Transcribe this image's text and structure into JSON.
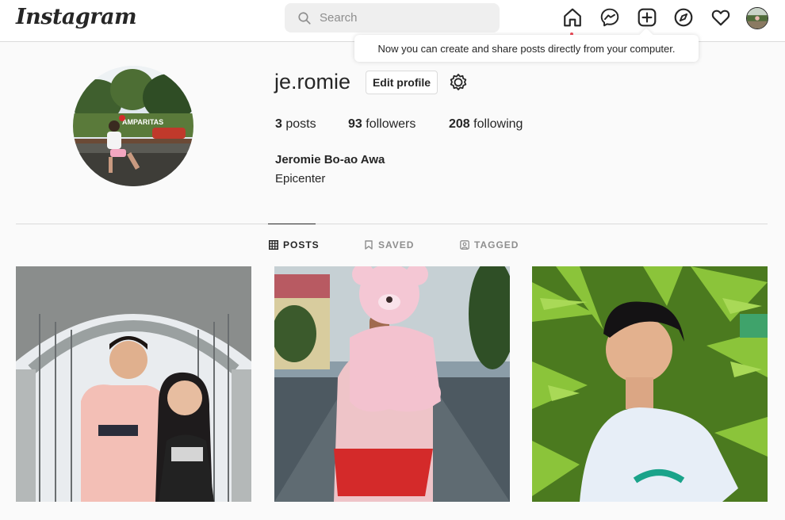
{
  "app": {
    "logo_text": "Instagram"
  },
  "search": {
    "placeholder": "Search"
  },
  "nav": {
    "icons": [
      "home-icon",
      "messenger-icon",
      "new-post-icon",
      "explore-icon",
      "activity-heart-icon",
      "profile-avatar"
    ]
  },
  "tooltip": {
    "text": "Now you can create and share posts directly from your computer."
  },
  "profile": {
    "username": "je.romie",
    "edit_label": "Edit profile",
    "posts_count": "3",
    "posts_label": "posts",
    "followers_count": "93",
    "followers_label": "followers",
    "following_count": "208",
    "following_label": "following",
    "full_name": "Jeromie Bo-ao Awa",
    "bio": "Epicenter"
  },
  "tabs": [
    {
      "label": "POSTS",
      "icon": "grid-icon",
      "active": true
    },
    {
      "label": "SAVED",
      "icon": "bookmark-icon",
      "active": false
    },
    {
      "label": "TAGGED",
      "icon": "tagged-icon",
      "active": false
    }
  ],
  "colors": {
    "notification_dot": "#ed4956",
    "border": "#dbdbdb",
    "text": "#262626",
    "muted": "#8e8e8e"
  }
}
